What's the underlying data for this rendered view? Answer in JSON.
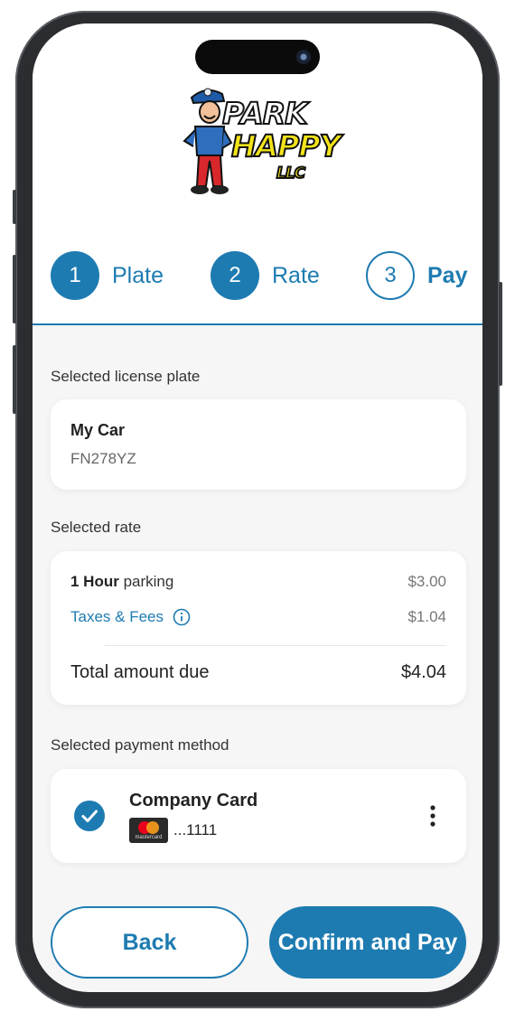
{
  "brand": {
    "line1": "PARK",
    "line2": "HAPPY",
    "line3": "LLC"
  },
  "steps": [
    {
      "number": "1",
      "label": "Plate"
    },
    {
      "number": "2",
      "label": "Rate"
    },
    {
      "number": "3",
      "label": "Pay"
    }
  ],
  "plate_section": {
    "heading": "Selected license plate",
    "name": "My Car",
    "plate": "FN278YZ"
  },
  "rate_section": {
    "heading": "Selected rate",
    "duration_bold": "1 Hour",
    "duration_rest": "parking",
    "parking_price": "$3.00",
    "taxes_label": "Taxes & Fees",
    "taxes_price": "$1.04",
    "total_label": "Total amount due",
    "total_price": "$4.04"
  },
  "payment_section": {
    "heading": "Selected payment method",
    "card_name": "Company Card",
    "card_brand": "mastercard",
    "card_last4": "...1111"
  },
  "actions": {
    "back": "Back",
    "confirm": "Confirm and Pay"
  },
  "colors": {
    "accent": "#1d7bb1"
  },
  "icons": [
    "info-icon",
    "checkmark-icon",
    "more-vertical-icon",
    "mastercard-icon"
  ]
}
